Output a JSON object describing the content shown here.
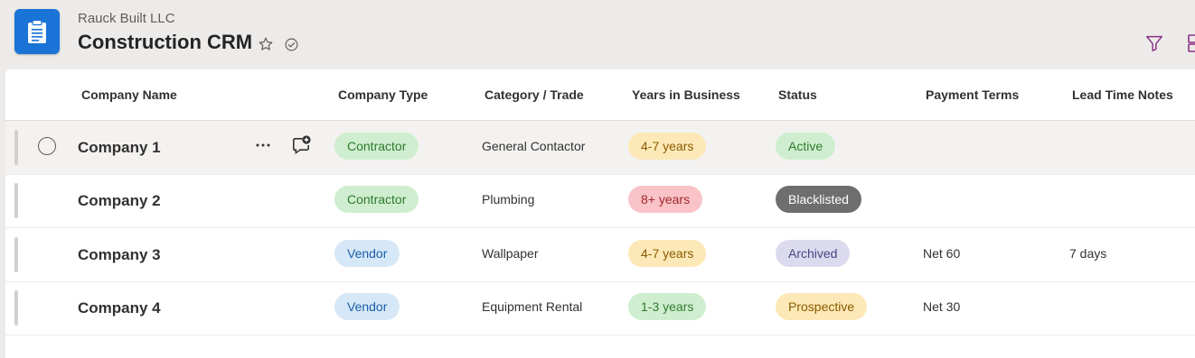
{
  "app": {
    "org_name": "Rauck Built LLC",
    "list_title": "Construction CRM",
    "icon": "clipboard-list-icon"
  },
  "toolbar": {
    "favorite_icon": "star-icon",
    "status_icon": "check-circle-icon",
    "filter_icon": "filter-icon"
  },
  "columns": [
    "Company Name",
    "Company Type",
    "Category / Trade",
    "Years in Business",
    "Status",
    "Payment Terms",
    "Lead Time Notes"
  ],
  "rows": [
    {
      "name": "Company 1",
      "type": "Contractor",
      "category": "General Contactor",
      "years": "4-7 years",
      "status": "Active",
      "payment": "",
      "lead_time": ""
    },
    {
      "name": "Company 2",
      "type": "Contractor",
      "category": "Plumbing",
      "years": "8+ years",
      "status": "Blacklisted",
      "payment": "",
      "lead_time": ""
    },
    {
      "name": "Company 3",
      "type": "Vendor",
      "category": "Wallpaper",
      "years": "4-7 years",
      "status": "Archived",
      "payment": "Net 60",
      "lead_time": "7 days"
    },
    {
      "name": "Company 4",
      "type": "Vendor",
      "category": "Equipment Rental",
      "years": "1-3 years",
      "status": "Prospective",
      "payment": "Net 30",
      "lead_time": ""
    }
  ],
  "colors": {
    "app_icon": "#1a73d6",
    "contractor": "#cfeecf",
    "vendor": "#d6e7f7",
    "years_4_7": "#fde9b7",
    "years_8_plus": "#f9c3c8",
    "years_1_3": "#cfeecf",
    "status_active": "#cfeecf",
    "status_blacklisted": "#6e6e6e",
    "status_archived": "#dcdaee",
    "status_prospective": "#fde9b7",
    "accent": "#8b2f84"
  }
}
